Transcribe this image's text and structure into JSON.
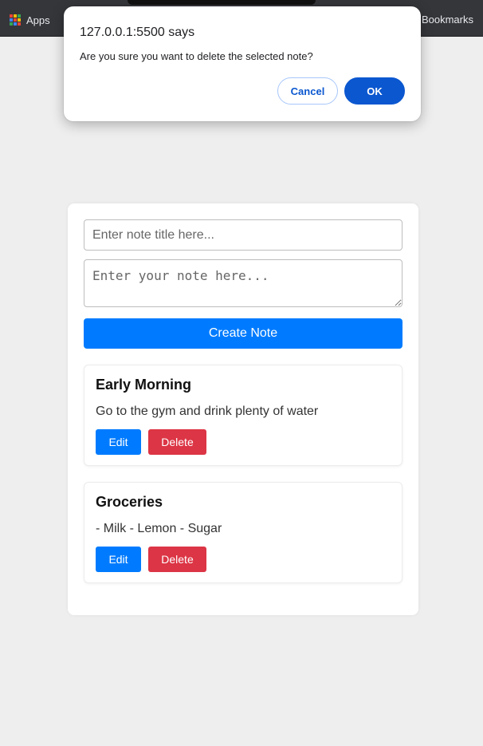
{
  "browser": {
    "bookmarks_bar": {
      "apps_label": "Apps",
      "bookmarks_label": "Bookmarks"
    }
  },
  "dialog": {
    "title": "127.0.0.1:5500 says",
    "message": "Are you sure you want to delete the selected note?",
    "cancel_label": "Cancel",
    "ok_label": "OK"
  },
  "app": {
    "title_placeholder": "Enter note title here...",
    "body_placeholder": "Enter your note here...",
    "create_label": "Create Note",
    "notes": [
      {
        "title": "Early Morning",
        "body": "Go to the gym and drink plenty of water",
        "edit_label": "Edit",
        "delete_label": "Delete"
      },
      {
        "title": "Groceries",
        "body": "- Milk - Lemon - Sugar",
        "edit_label": "Edit",
        "delete_label": "Delete"
      }
    ]
  },
  "colors": {
    "primary": "#007bff",
    "danger": "#dc3545",
    "dialog_accent": "#0b57d0"
  }
}
